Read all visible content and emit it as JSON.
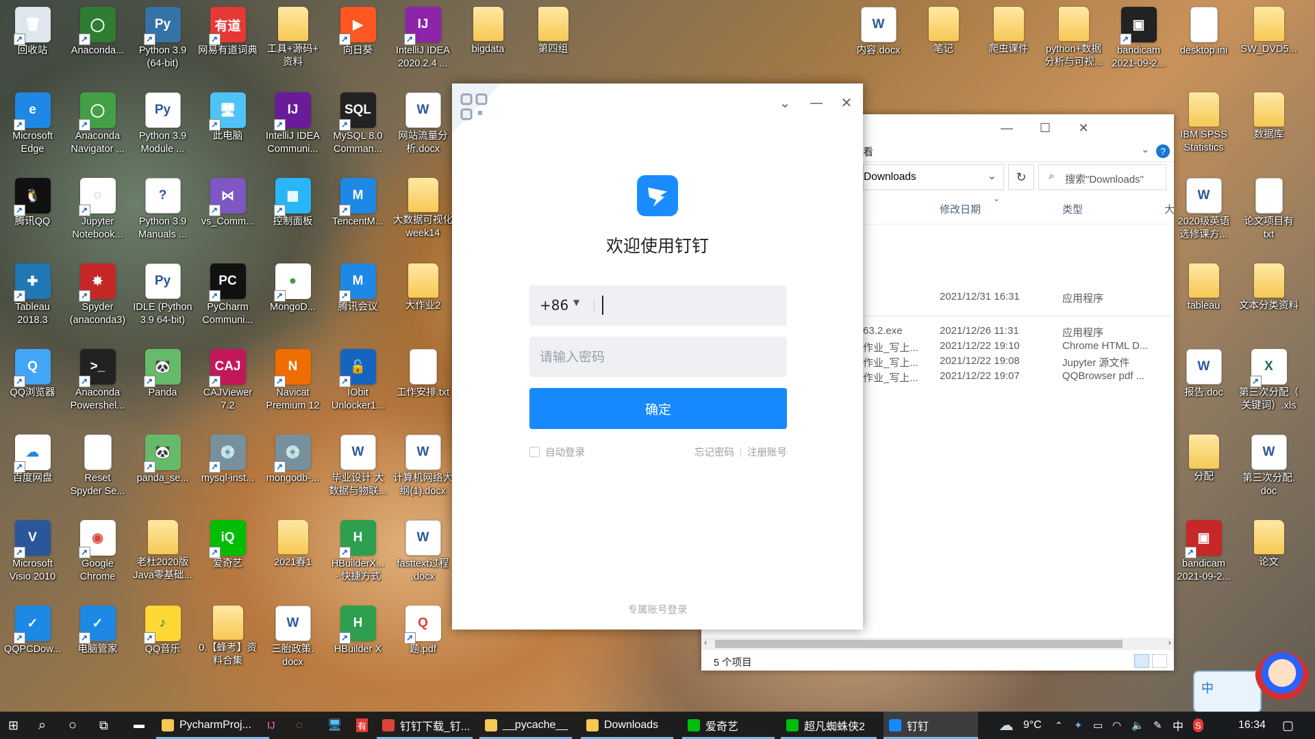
{
  "desktop": {
    "icons": [
      {
        "label": "回收站",
        "x": 0,
        "y": 0,
        "bg": "#dfe6ee",
        "glyph": "🗑"
      },
      {
        "label": "Anaconda...",
        "x": 1,
        "y": 0,
        "bg": "#2e7d32",
        "glyph": "◯"
      },
      {
        "label": "Python 3.9\n(64-bit)",
        "x": 2,
        "y": 0,
        "bg": "#3572a5",
        "glyph": "Py"
      },
      {
        "label": "网易有道词典",
        "x": 3,
        "y": 0,
        "bg": "#e53935",
        "glyph": "有道"
      },
      {
        "label": "工具+源码+\n资料",
        "x": 4,
        "y": 0,
        "type": "folder"
      },
      {
        "label": "向日葵",
        "x": 5,
        "y": 0,
        "bg": "#ff5722",
        "glyph": "▶"
      },
      {
        "label": "IntelliJ IDEA\n2020.2.4 ...",
        "x": 6,
        "y": 0,
        "bg": "#8e24aa",
        "glyph": "IJ"
      },
      {
        "label": "bigdata",
        "x": 7,
        "y": 0,
        "type": "folder"
      },
      {
        "label": "第四组",
        "x": 8,
        "y": 0,
        "type": "folder"
      },
      {
        "label": "Microsoft\nEdge",
        "x": 0,
        "y": 1,
        "bg": "#1e88e5",
        "glyph": "e"
      },
      {
        "label": "Anaconda\nNavigator ...",
        "x": 1,
        "y": 1,
        "bg": "#43a047",
        "glyph": "◯"
      },
      {
        "label": "Python 3.9\nModule ...",
        "x": 2,
        "y": 1,
        "type": "doc",
        "glyph": "Py"
      },
      {
        "label": "此电脑",
        "x": 3,
        "y": 1,
        "bg": "#4fc3f7",
        "glyph": "🖥"
      },
      {
        "label": "IntelliJ IDEA\nCommuni...",
        "x": 4,
        "y": 1,
        "bg": "#6a1b9a",
        "glyph": "IJ"
      },
      {
        "label": "MySQL 8.0\nComman...",
        "x": 5,
        "y": 1,
        "bg": "#222",
        "glyph": "SQL"
      },
      {
        "label": "网站流量分\n析.docx",
        "x": 6,
        "y": 1,
        "type": "doc",
        "glyph": "W"
      },
      {
        "label": "腾讯QQ",
        "x": 0,
        "y": 2,
        "bg": "#111",
        "glyph": "🐧"
      },
      {
        "label": "Jupyter\nNotebook...",
        "x": 1,
        "y": 2,
        "bg": "#fff",
        "glyph": "◌",
        "fg": "#f37626"
      },
      {
        "label": "Python 3.9\nManuals ...",
        "x": 2,
        "y": 2,
        "type": "doc",
        "glyph": "?"
      },
      {
        "label": "vs_Comm...",
        "x": 3,
        "y": 2,
        "bg": "#7e57c2",
        "glyph": "⋈"
      },
      {
        "label": "控制面板",
        "x": 4,
        "y": 2,
        "bg": "#29b6f6",
        "glyph": "▦"
      },
      {
        "label": "TencentM...",
        "x": 5,
        "y": 2,
        "bg": "#1e88e5",
        "glyph": "M"
      },
      {
        "label": "大数据可视化\nweek14",
        "x": 6,
        "y": 2,
        "type": "folder"
      },
      {
        "label": "Tableau\n2018.3",
        "x": 0,
        "y": 3,
        "bg": "#1f77b4",
        "glyph": "✚"
      },
      {
        "label": "Spyder\n(anaconda3)",
        "x": 1,
        "y": 3,
        "bg": "#c62828",
        "glyph": "✸"
      },
      {
        "label": "IDLE (Python\n3.9 64-bit)",
        "x": 2,
        "y": 3,
        "type": "doc",
        "glyph": "Py"
      },
      {
        "label": "PyCharm\nCommuni...",
        "x": 3,
        "y": 3,
        "bg": "#111",
        "glyph": "PC"
      },
      {
        "label": "MongoD...",
        "x": 4,
        "y": 3,
        "bg": "#fff",
        "glyph": "●",
        "fg": "#43a047"
      },
      {
        "label": "腾讯会议",
        "x": 5,
        "y": 3,
        "bg": "#1e88e5",
        "glyph": "M"
      },
      {
        "label": "大作业2",
        "x": 6,
        "y": 3,
        "type": "folder"
      },
      {
        "label": "QQ浏览器",
        "x": 0,
        "y": 4,
        "bg": "#42a5f5",
        "glyph": "Q"
      },
      {
        "label": "Anaconda\nPowershel...",
        "x": 1,
        "y": 4,
        "bg": "#222",
        "glyph": ">_"
      },
      {
        "label": "Panda",
        "x": 2,
        "y": 4,
        "bg": "#66bb6a",
        "glyph": "🐼"
      },
      {
        "label": "CAJViewer\n7.2",
        "x": 3,
        "y": 4,
        "bg": "#c2185b",
        "glyph": "CAJ"
      },
      {
        "label": "Navicat\nPremium 12",
        "x": 4,
        "y": 4,
        "bg": "#ef6c00",
        "glyph": "N"
      },
      {
        "label": "IObit\nUnlocker1...",
        "x": 5,
        "y": 4,
        "bg": "#1565c0",
        "glyph": "🔓"
      },
      {
        "label": "工作安排.txt",
        "x": 6,
        "y": 4,
        "type": "file"
      },
      {
        "label": "百度网盘",
        "x": 0,
        "y": 5,
        "bg": "#fff",
        "glyph": "☁",
        "fg": "#1e88e5"
      },
      {
        "label": "Reset\nSpyder Se...",
        "x": 1,
        "y": 5,
        "type": "file"
      },
      {
        "label": "panda_se...",
        "x": 2,
        "y": 5,
        "bg": "#66bb6a",
        "glyph": "🐼"
      },
      {
        "label": "mysql-inst...",
        "x": 3,
        "y": 5,
        "bg": "#78909c",
        "glyph": "💿"
      },
      {
        "label": "mongodb-...",
        "x": 4,
        "y": 5,
        "bg": "#78909c",
        "glyph": "💿"
      },
      {
        "label": "毕业设计  大\n数据与物联...",
        "x": 5,
        "y": 5,
        "type": "doc",
        "glyph": "W"
      },
      {
        "label": "计算机网络大\n纲(1).docx",
        "x": 6,
        "y": 5,
        "type": "doc",
        "glyph": "W"
      },
      {
        "label": "Microsoft\nVisio 2010",
        "x": 0,
        "y": 6,
        "bg": "#2b579a",
        "glyph": "V"
      },
      {
        "label": "Google\nChrome",
        "x": 1,
        "y": 6,
        "bg": "#fff",
        "glyph": "◉",
        "fg": "#db4437"
      },
      {
        "label": "老杜2020版\nJava零基础...",
        "x": 2,
        "y": 6,
        "type": "folder"
      },
      {
        "label": "爱奇艺",
        "x": 3,
        "y": 6,
        "bg": "#00be06",
        "glyph": "iQ"
      },
      {
        "label": "2021春1",
        "x": 4,
        "y": 6,
        "type": "folder"
      },
      {
        "label": "HBuilderX...\n- 快捷方式",
        "x": 5,
        "y": 6,
        "bg": "#2e9e4f",
        "glyph": "H"
      },
      {
        "label": "fasttext过程\n.docx",
        "x": 6,
        "y": 6,
        "type": "doc",
        "glyph": "W"
      },
      {
        "label": "QQPCDow...",
        "x": 0,
        "y": 7,
        "bg": "#1e88e5",
        "glyph": "✓"
      },
      {
        "label": "电脑管家",
        "x": 1,
        "y": 7,
        "bg": "#1e88e5",
        "glyph": "✓"
      },
      {
        "label": "QQ音乐",
        "x": 2,
        "y": 7,
        "bg": "#fdd835",
        "glyph": "♪",
        "fg": "#2e7d32"
      },
      {
        "label": "0.【蜂考】资\n料合集",
        "x": 3,
        "y": 7,
        "type": "folder"
      },
      {
        "label": "三胎政策.\ndocx",
        "x": 4,
        "y": 7,
        "type": "doc",
        "glyph": "W"
      },
      {
        "label": "HBuilder X",
        "x": 5,
        "y": 7,
        "bg": "#2e9e4f",
        "glyph": "H"
      },
      {
        "label": "题.pdf",
        "x": 6,
        "y": 7,
        "bg": "#fff",
        "glyph": "Q",
        "fg": "#e53935"
      },
      {
        "label": "内容.docx",
        "x": 13,
        "y": 0,
        "type": "doc",
        "glyph": "W"
      },
      {
        "label": "笔记",
        "x": 14,
        "y": 0,
        "type": "folder"
      },
      {
        "label": "爬虫课件",
        "x": 15,
        "y": 0,
        "type": "folder"
      },
      {
        "label": "python+数据\n分析与可视...",
        "x": 16,
        "y": 0,
        "type": "folder"
      },
      {
        "label": "bandicam\n2021-09-2...",
        "x": 17,
        "y": 0,
        "bg": "#222",
        "glyph": "▣"
      },
      {
        "label": "desktop.ini",
        "x": 18,
        "y": 0,
        "type": "file"
      },
      {
        "label": "SW_DVD5...",
        "x": 19,
        "y": 0,
        "type": "folder"
      },
      {
        "label": "IBM SPSS\nStatistics",
        "x": 18,
        "y": 1,
        "type": "folder"
      },
      {
        "label": "数据库",
        "x": 19,
        "y": 1,
        "type": "folder"
      },
      {
        "label": "2020级英语\n选修课方...",
        "x": 18,
        "y": 2,
        "type": "doc",
        "glyph": "W"
      },
      {
        "label": "论文项目有\ntxt",
        "x": 19,
        "y": 2,
        "type": "file"
      },
      {
        "label": "tableau",
        "x": 18,
        "y": 3,
        "type": "folder"
      },
      {
        "label": "文本分类资料",
        "x": 19,
        "y": 3,
        "type": "folder"
      },
      {
        "label": "报告.doc",
        "x": 18,
        "y": 4,
        "type": "doc",
        "glyph": "W"
      },
      {
        "label": "第三次分配（\n关键词）.xls",
        "x": 19,
        "y": 4,
        "bg": "#fff",
        "glyph": "X",
        "fg": "#1d6f42"
      },
      {
        "label": "分配",
        "x": 18,
        "y": 5,
        "type": "folder"
      },
      {
        "label": "第三次分配.\ndoc",
        "x": 19,
        "y": 5,
        "type": "doc",
        "glyph": "W"
      },
      {
        "label": "bandicam\n2021-09-2...",
        "x": 18,
        "y": 6,
        "bg": "#c62828",
        "glyph": "▣"
      },
      {
        "label": "论文",
        "x": 19,
        "y": 6,
        "type": "folder"
      }
    ]
  },
  "dingtalk": {
    "welcome": "欢迎使用钉钉",
    "country_code": "+86",
    "password_placeholder": "请输入密码",
    "confirm_label": "确定",
    "auto_login": "自动登录",
    "forgot_password": "忘记密码",
    "register": "注册账号",
    "exclusive_login": "专属账号登录",
    "brand_color": "#1689fe"
  },
  "explorer": {
    "ribbon_tail": "看",
    "address": "Downloads",
    "search_placeholder": "搜索\"Downloads\"",
    "columns": {
      "modified": "修改日期",
      "type": "类型",
      "size": "大"
    },
    "rows": [
      {
        "name": "",
        "modified": "2021/12/31 16:31",
        "type": "应用程序"
      },
      {
        "name": "63.2.exe",
        "modified": "2021/12/26 11:31",
        "type": "应用程序"
      },
      {
        "name": "作业_写上...",
        "modified": "2021/12/22 19:10",
        "type": "Chrome HTML D..."
      },
      {
        "name": "作业_写上...",
        "modified": "2021/12/22 19:08",
        "type": "Jupyter 源文件"
      },
      {
        "name": "作业_写上...",
        "modified": "2021/12/22 19:07",
        "type": "QQBrowser pdf ..."
      }
    ],
    "status": "5 个项目"
  },
  "taskbar": {
    "apps": [
      {
        "label": "PycharmProj...",
        "color": "#f6c855"
      },
      {
        "label": "钉钉下载_钉...",
        "color": "#db4437"
      },
      {
        "label": "__pycache__",
        "color": "#f6c855"
      },
      {
        "label": "Downloads",
        "color": "#f6c855"
      },
      {
        "label": "爱奇艺",
        "color": "#00be06"
      },
      {
        "label": "超凡蜘蛛侠2",
        "color": "#00be06"
      },
      {
        "label": "钉钉",
        "color": "#1689fe"
      }
    ],
    "weather": "9°C",
    "ime": "中",
    "time": "16:34"
  },
  "overlay": {
    "ime_text": "中"
  }
}
